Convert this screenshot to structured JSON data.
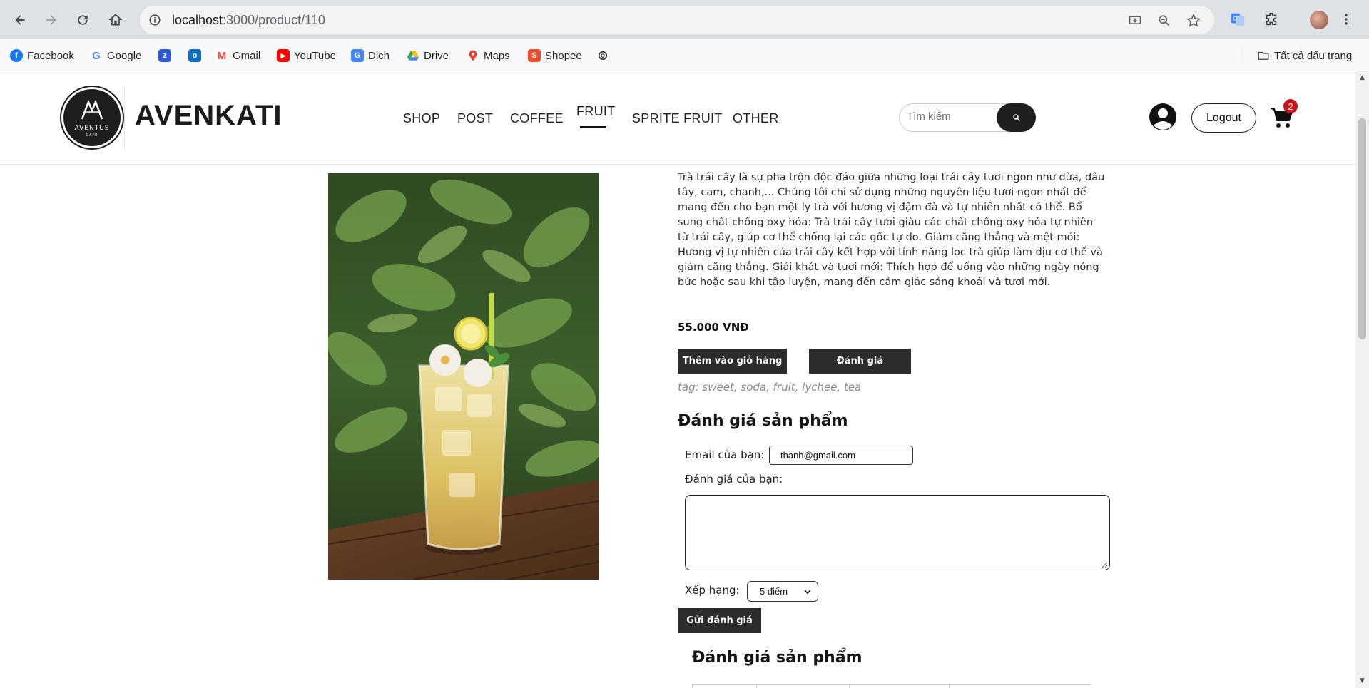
{
  "browser": {
    "url_host": "localhost",
    "url_path": ":3000/product/110",
    "bookmarks": [
      {
        "label": "Facebook",
        "icon": "facebook-icon",
        "color": "#1877f2"
      },
      {
        "label": "Google",
        "icon": "google-icon",
        "color": "#4285f4"
      },
      {
        "label": "",
        "icon": "zing-icon",
        "color": "#2d5bd3"
      },
      {
        "label": "",
        "icon": "outlook-icon",
        "color": "#0f6cbd"
      },
      {
        "label": "Gmail",
        "icon": "gmail-icon",
        "color": "#ea4335"
      },
      {
        "label": "YouTube",
        "icon": "youtube-icon",
        "color": "#ff0000"
      },
      {
        "label": "Dịch",
        "icon": "translate-icon",
        "color": "#4285f4"
      },
      {
        "label": "Drive",
        "icon": "drive-icon",
        "color": "#34a853"
      },
      {
        "label": "Maps",
        "icon": "maps-icon",
        "color": "#ea4335"
      },
      {
        "label": "Shopee",
        "icon": "shopee-icon",
        "color": "#ee4d2d"
      },
      {
        "label": "",
        "icon": "chatgpt-icon",
        "color": "#222222"
      }
    ],
    "all_bookmarks_label": "Tất cả dấu trang"
  },
  "header": {
    "logo_text": "AVENTUS",
    "logo_subtext": "CAFE",
    "brand": "AVENKATI",
    "menu": [
      "SHOP",
      "POST",
      "COFFEE",
      "FRUIT",
      "SPRITE FRUIT",
      "OTHER"
    ],
    "active_menu": "FRUIT",
    "search_placeholder": "Tìm kiếm",
    "logout_label": "Logout",
    "cart_count": "2"
  },
  "product": {
    "description": "Trà trái cây là sự pha trộn độc đáo giữa những loại trái cây tươi ngon như dừa, dâu tây, cam, chanh,... Chúng tôi chỉ sử dụng những nguyên liệu tươi ngon nhất để mang đến cho bạn một ly trà với hương vị đậm đà và tự nhiên nhất có thể. Bổ sung chất chống oxy hóa: Trà trái cây tươi giàu các chất chống oxy hóa tự nhiên từ trái cây, giúp cơ thể chống lại các gốc tự do. Giảm căng thẳng và mệt mỏi: Hương vị tự nhiên của trái cây kết hợp với tính năng lọc trà giúp làm dịu cơ thể và giảm căng thẳng. Giải khát và tươi mới: Thích hợp để uống vào những ngày nóng bức hoặc sau khi tập luyện, mang đến cảm giác sảng khoái và tươi mới.",
    "price": "55.000 VNĐ",
    "add_to_cart_label": "Thêm vào giỏ hàng",
    "review_button_label": "Đánh giá",
    "tags": "tag: sweet, soda, fruit, lychee, tea"
  },
  "review_form": {
    "title": "Đánh giá sản phẩm",
    "email_label": "Email của bạn:",
    "email_value": "thanh@gmail.com",
    "review_label": "Đánh giá của bạn:",
    "review_value": "",
    "rating_label": "Xếp hạng:",
    "rating_value": "5 điểm",
    "submit_label": "Gửi đánh giá"
  },
  "reviews_list": {
    "title": "Đánh giá sản phẩm"
  }
}
